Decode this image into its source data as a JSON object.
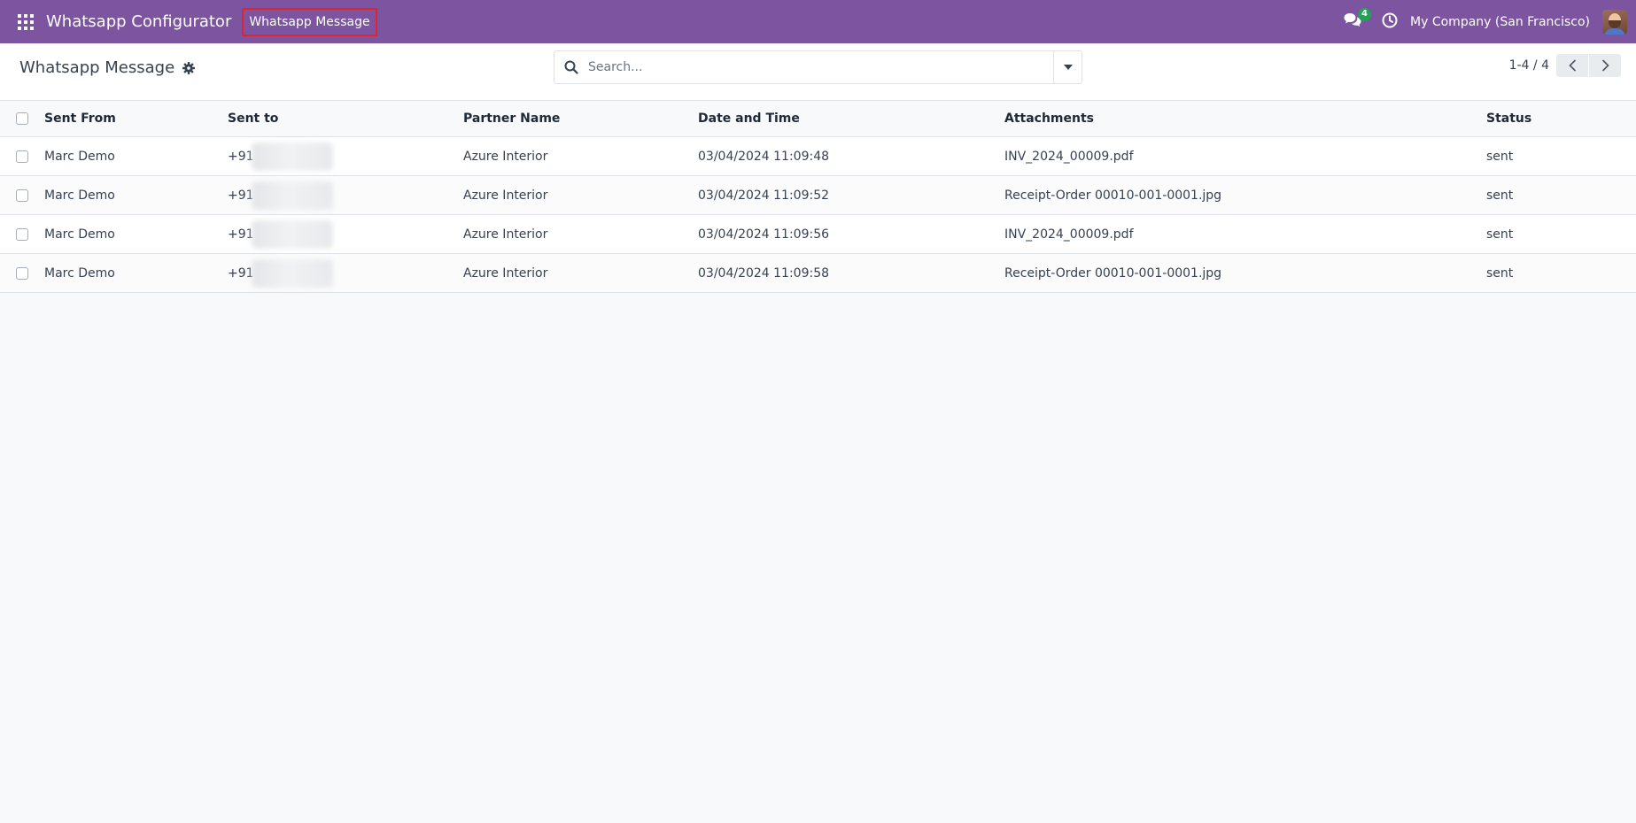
{
  "navbar": {
    "app_name": "Whatsapp Configurator",
    "menu_item": "Whatsapp Message",
    "chat_count": "4",
    "company": "My Company (San Francisco)"
  },
  "control_panel": {
    "title": "Whatsapp Message",
    "search_placeholder": "Search...",
    "pager": "1-4 / 4"
  },
  "table": {
    "columns": [
      "Sent From",
      "Sent to",
      "Partner Name",
      "Date and Time",
      "Attachments",
      "Status"
    ],
    "rows": [
      {
        "sent_from": "Marc Demo",
        "sent_to": "+91",
        "partner": "Azure Interior",
        "datetime": "03/04/2024 11:09:48",
        "attachment": "INV_2024_00009.pdf",
        "status": "sent"
      },
      {
        "sent_from": "Marc Demo",
        "sent_to": "+91",
        "partner": "Azure Interior",
        "datetime": "03/04/2024 11:09:52",
        "attachment": "Receipt-Order 00010-001-0001.jpg",
        "status": "sent"
      },
      {
        "sent_from": "Marc Demo",
        "sent_to": "+91",
        "partner": "Azure Interior",
        "datetime": "03/04/2024 11:09:56",
        "attachment": "INV_2024_00009.pdf",
        "status": "sent"
      },
      {
        "sent_from": "Marc Demo",
        "sent_to": "+91",
        "partner": "Azure Interior",
        "datetime": "03/04/2024 11:09:58",
        "attachment": "Receipt-Order 00010-001-0001.jpg",
        "status": "sent"
      }
    ]
  },
  "icons": {
    "apps": "apps-grid-icon",
    "chat": "chat-icon",
    "clock": "clock-icon",
    "gear": "gear-icon",
    "search": "search-icon",
    "dropdown": "caret-down-icon",
    "prev": "chevron-left-icon",
    "next": "chevron-right-icon"
  },
  "colors": {
    "navbar": "#7c549f",
    "menu_highlight": "#e0242d",
    "badge": "#21a352"
  }
}
